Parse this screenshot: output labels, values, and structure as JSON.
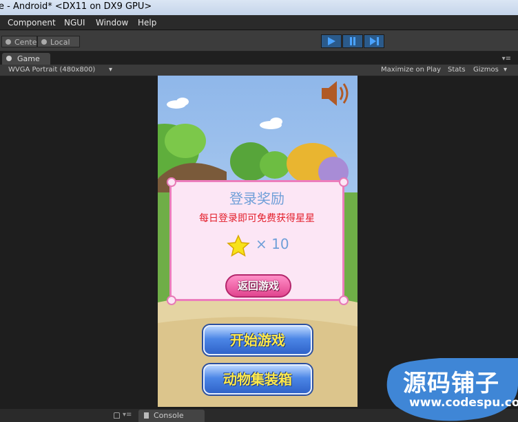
{
  "window": {
    "title": "e - Android* <DX11 on DX9 GPU>"
  },
  "menu": {
    "items": [
      "Component",
      "NGUI",
      "Window",
      "Help"
    ]
  },
  "toolbar": {
    "pivot_center": "Center",
    "pivot_local": "Local"
  },
  "tabs": {
    "game": "Game"
  },
  "game_toolbar": {
    "resolution": "WVGA Portrait (480x800)",
    "maximize_on_play": "Maximize on Play",
    "stats": "Stats",
    "gizmos": "Gizmos"
  },
  "game": {
    "dialog": {
      "title": "登录奖励",
      "subtitle": "每日登录即可免费获得星星",
      "reward_count": "× 10",
      "return_button": "返回游戏"
    },
    "start_button": "开始游戏",
    "collection_button": "动物集装箱"
  },
  "bottom": {
    "console_tab": "Console"
  },
  "watermark": {
    "name": "源码铺子",
    "url": "www.codespu.com"
  },
  "colors": {
    "accent_pink": "#ec7dbc",
    "dialog_title": "#6f9fd8",
    "subtitle_red": "#e31e2a",
    "button_blue": "#4c86e6"
  }
}
